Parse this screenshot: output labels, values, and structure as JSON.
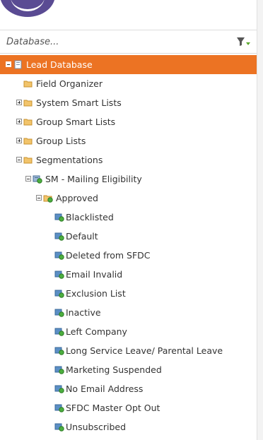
{
  "search": {
    "placeholder": "Database..."
  },
  "tree": {
    "root": {
      "label": "Lead Database",
      "icon": "database-icon",
      "selected": true,
      "color": "#ec7323"
    },
    "items": [
      {
        "label": "Field Organizer",
        "icon": "folder-icon"
      },
      {
        "label": "System Smart Lists",
        "icon": "folder-icon",
        "expander": "collapsed"
      },
      {
        "label": "Group Smart Lists",
        "icon": "folder-icon",
        "expander": "collapsed"
      },
      {
        "label": "Group Lists",
        "icon": "folder-icon",
        "expander": "collapsed"
      },
      {
        "label": "Segmentations",
        "icon": "folder-icon",
        "expander": "expanded"
      },
      {
        "label": "SM - Mailing Eligibility",
        "icon": "segmentation-icon",
        "expander": "expanded"
      },
      {
        "label": "Approved",
        "icon": "approved-folder-icon",
        "expander": "expanded"
      },
      {
        "label": "Blacklisted",
        "icon": "segment-icon"
      },
      {
        "label": "Default",
        "icon": "segment-icon"
      },
      {
        "label": "Deleted from SFDC",
        "icon": "segment-icon"
      },
      {
        "label": "Email Invalid",
        "icon": "segment-icon"
      },
      {
        "label": "Exclusion List",
        "icon": "segment-icon"
      },
      {
        "label": "Inactive",
        "icon": "segment-icon"
      },
      {
        "label": "Left Company",
        "icon": "segment-icon"
      },
      {
        "label": "Long Service Leave/ Parental Leave",
        "icon": "segment-icon"
      },
      {
        "label": "Marketing Suspended",
        "icon": "segment-icon"
      },
      {
        "label": "No Email Address",
        "icon": "segment-icon"
      },
      {
        "label": "SFDC Master Opt Out",
        "icon": "segment-icon"
      },
      {
        "label": "Unsubscribed",
        "icon": "segment-icon"
      }
    ]
  }
}
